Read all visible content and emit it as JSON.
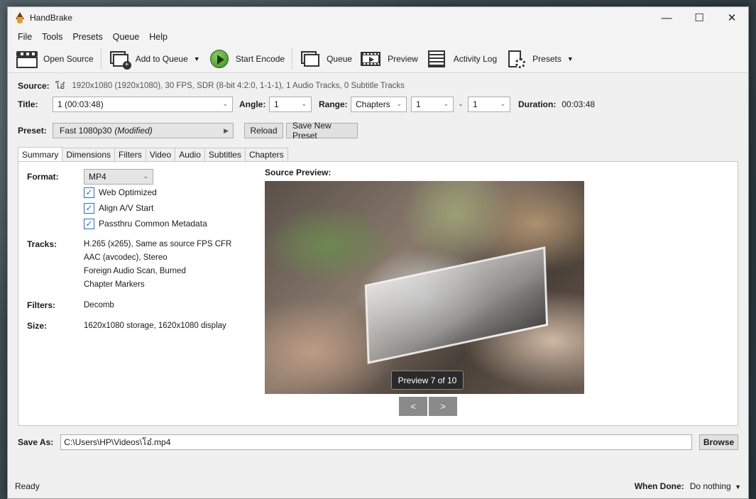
{
  "window": {
    "title": "HandBrake",
    "controls": [
      "—",
      "☐",
      "✕"
    ]
  },
  "menu": [
    "File",
    "Tools",
    "Presets",
    "Queue",
    "Help"
  ],
  "toolbar": {
    "open_source": "Open Source",
    "add_to_queue": "Add to Queue",
    "start_encode": "Start Encode",
    "queue": "Queue",
    "preview": "Preview",
    "activity_log": "Activity Log",
    "presets": "Presets"
  },
  "source": {
    "label": "Source:",
    "name": "โอ๋",
    "info": "1920x1080 (1920x1080), 30 FPS, SDR (8-bit 4:2:0, 1-1-1), 1 Audio Tracks, 0 Subtitle Tracks"
  },
  "title_row": {
    "title_label": "Title:",
    "title_value": "1  (00:03:48)",
    "angle_label": "Angle:",
    "angle_value": "1",
    "range_label": "Range:",
    "range_value": "Chapters",
    "range_start": "1",
    "range_dash": "-",
    "range_end": "1",
    "duration_label": "Duration:",
    "duration_value": "00:03:48"
  },
  "preset_row": {
    "label": "Preset:",
    "value": "Fast 1080p30",
    "modified": "(Modified)",
    "reload": "Reload",
    "save_new": "Save New Preset"
  },
  "tabs": [
    "Summary",
    "Dimensions",
    "Filters",
    "Video",
    "Audio",
    "Subtitles",
    "Chapters"
  ],
  "summary": {
    "format_label": "Format:",
    "format_value": "MP4",
    "checks": [
      "Web Optimized",
      "Align A/V Start",
      "Passthru Common Metadata"
    ],
    "tracks_label": "Tracks:",
    "tracks": [
      "H.265 (x265), Same as source FPS CFR",
      "AAC (avcodec), Stereo",
      "Foreign Audio Scan, Burned",
      "Chapter Markers"
    ],
    "filters_label": "Filters:",
    "filters_value": "Decomb",
    "size_label": "Size:",
    "size_value": "1620x1080 storage, 1620x1080 display",
    "preview_label": "Source Preview:",
    "preview_badge": "Preview 7 of 10",
    "prev_btn": "<",
    "next_btn": ">"
  },
  "save_as": {
    "label": "Save As:",
    "path": "C:\\Users\\HP\\Videos\\โอ๋.mp4",
    "browse": "Browse"
  },
  "status": {
    "text": "Ready",
    "when_done_label": "When Done:",
    "when_done_value": "Do nothing"
  }
}
